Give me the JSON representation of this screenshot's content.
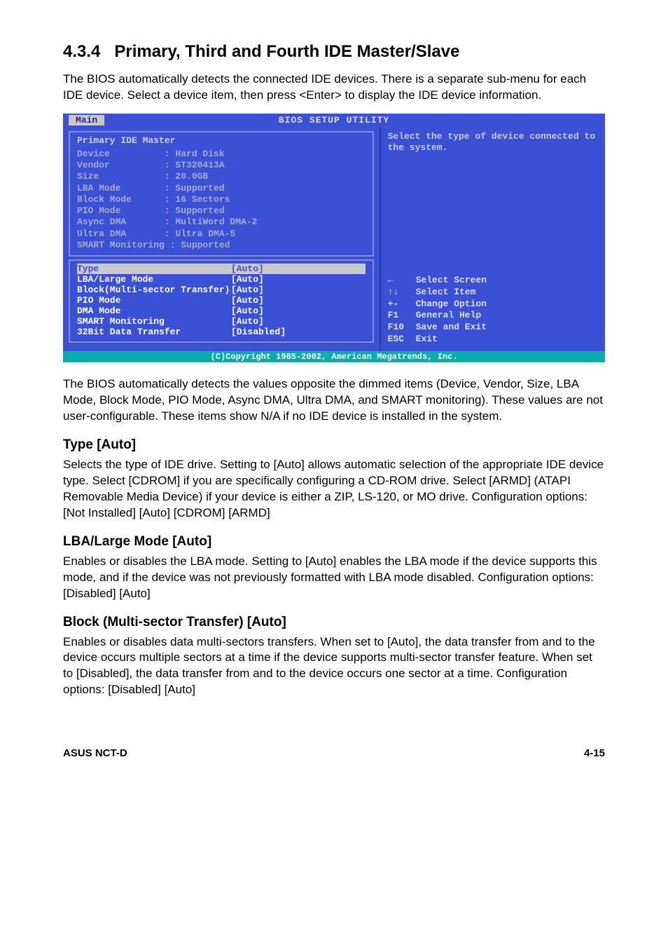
{
  "section": {
    "number": "4.3.4",
    "title": "Primary, Third and Fourth IDE Master/Slave",
    "intro": "The BIOS automatically detects the connected IDE devices. There is a separate sub-menu for each IDE device. Select a device item, then press <Enter> to display the IDE device information."
  },
  "bios": {
    "header_title": "BIOS SETUP UTILITY",
    "tab": "Main",
    "panel_title": "Primary IDE Master",
    "info": {
      "Device": "Hard Disk",
      "Vendor": "ST320413A",
      "Size": "20.0GB",
      "LBA Mode": "Supported",
      "Block Mode": "16 Sectors",
      "PIO Mode": "Supported",
      "Async DMA": "MultiWord DMA-2",
      "Ultra DMA": "Ultra DMA-5",
      "SMART Monitoring": "Supported"
    },
    "options": [
      {
        "label": "Type",
        "value": "[Auto]",
        "highlight": true
      },
      {
        "label": "LBA/Large Mode",
        "value": "[Auto]"
      },
      {
        "label": "Block(Multi-sector Transfer)",
        "value": "[Auto]"
      },
      {
        "label": "PIO Mode",
        "value": "[Auto]"
      },
      {
        "label": "DMA Mode",
        "value": "[Auto]"
      },
      {
        "label": "SMART Monitoring",
        "value": "[Auto]"
      },
      {
        "label": "32Bit Data Transfer",
        "value": "[Disabled]"
      }
    ],
    "help_text": "Select the type of device connected to the system.",
    "keys": [
      {
        "key": "←",
        "desc": "Select Screen"
      },
      {
        "key": "↑↓",
        "desc": "Select Item"
      },
      {
        "key": "+-",
        "desc": "Change Option"
      },
      {
        "key": "F1",
        "desc": "General Help"
      },
      {
        "key": "F10",
        "desc": "Save and Exit"
      },
      {
        "key": "ESC",
        "desc": "Exit"
      }
    ],
    "footer": "(C)Copyright 1985-2002, American Megatrends, Inc."
  },
  "after_bios": "The BIOS automatically detects the values opposite the dimmed items (Device, Vendor, Size, LBA Mode, Block Mode, PIO Mode, Async DMA, Ultra DMA, and SMART monitoring). These values are not user-configurable. These items show N/A if no IDE device is installed in the system.",
  "type_section": {
    "title": "Type [Auto]",
    "body": "Selects the type of IDE drive. Setting to [Auto] allows automatic selection of the appropriate IDE device type. Select [CDROM] if you are specifically configuring a CD-ROM drive. Select [ARMD] (ATAPI Removable Media Device) if your device is either a ZIP, LS-120, or MO drive. Configuration options: [Not Installed] [Auto] [CDROM] [ARMD]"
  },
  "lba_section": {
    "title": "LBA/Large Mode [Auto]",
    "body": "Enables or disables the LBA mode. Setting to [Auto] enables the LBA mode if the device supports this mode, and if the device was not previously formatted with LBA mode disabled. Configuration options: [Disabled] [Auto]"
  },
  "block_section": {
    "title": "Block (Multi-sector Transfer) [Auto]",
    "body": "Enables or disables data multi-sectors transfers. When set to [Auto], the data transfer from and to the device occurs multiple sectors at a time if the device supports multi-sector transfer feature. When set to [Disabled], the data transfer from and to the device occurs one sector at a time. Configuration options: [Disabled] [Auto]"
  },
  "footer": {
    "left": "ASUS NCT-D",
    "right": "4-15"
  }
}
